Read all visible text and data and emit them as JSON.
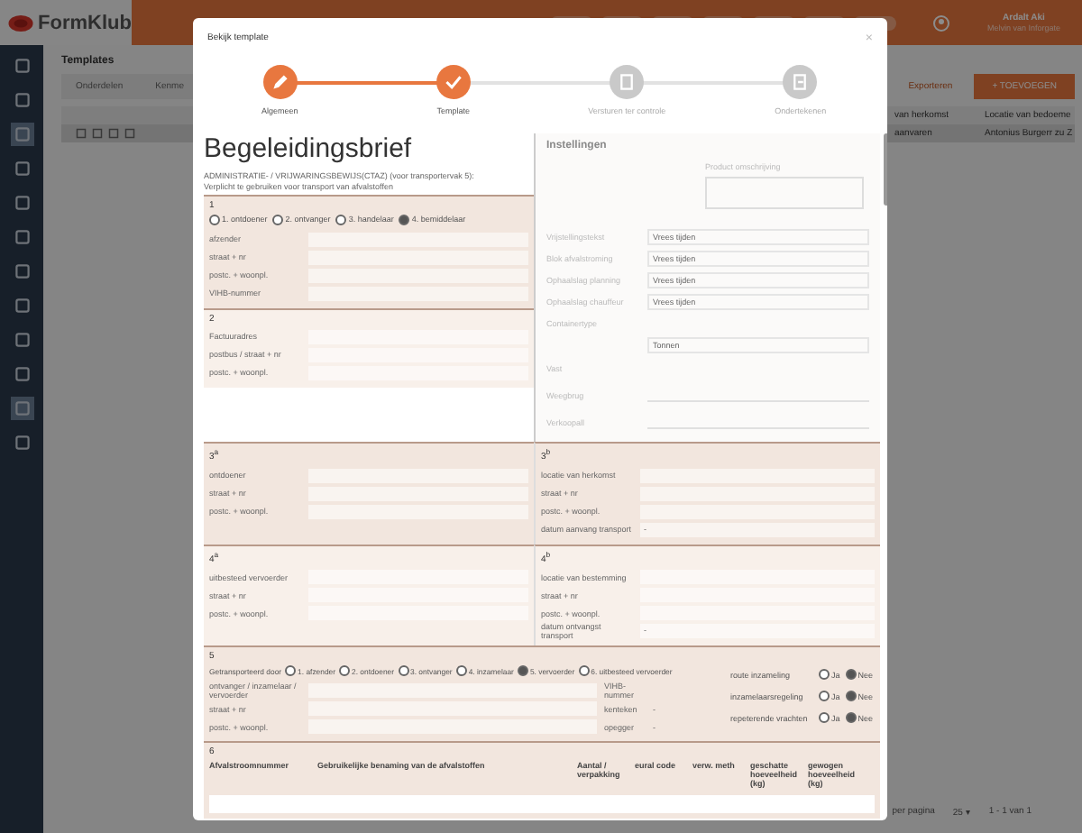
{
  "app": {
    "brand": "FormKlub",
    "user_name": "Ardalt Aki",
    "user_org": "Melvin van Inforgate",
    "page_title": "Templates",
    "tabs": [
      "Onderdelen",
      "Kenme"
    ],
    "actions": [
      "Exporteren",
      "+ TOEVOEGEN"
    ],
    "columns": [
      "van herkomst",
      "Locatie van bedoeme"
    ],
    "row": [
      "aanvaren",
      "Antonius Burgerr zu Z"
    ],
    "pagination": [
      "per pagina",
      "25 ▾",
      "1 - 1 van 1"
    ],
    "nav_items": [
      {
        "selected": false
      },
      {
        "selected": false
      },
      {
        "selected": true
      },
      {
        "selected": false
      },
      {
        "selected": false
      },
      {
        "selected": false
      },
      {
        "selected": false
      },
      {
        "selected": false
      },
      {
        "selected": false
      },
      {
        "selected": false
      },
      {
        "selected": true
      },
      {
        "selected": false
      }
    ]
  },
  "modal": {
    "title": "Bekijk template",
    "close": "×",
    "steps": [
      {
        "label": "Algemeen",
        "completed": true
      },
      {
        "label": "Template",
        "completed": true
      },
      {
        "label": "Versturen ter controle",
        "completed": false
      },
      {
        "label": "Ondertekenen",
        "completed": false
      }
    ]
  },
  "form": {
    "title": "Begeleidingsbrief",
    "intro": "ADMINISTRATIE- / VRIJWARINGSBEWIJS(CTAZ) (voor transportervak 5):",
    "intro_2": "Verplicht te gebruiken voor transport van afvalstoffen",
    "section_1": {
      "number": "1",
      "radios": [
        {
          "label": "1. ontdoener",
          "selected": false
        },
        {
          "label": "2. ontvanger",
          "selected": false
        },
        {
          "label": "3. handelaar",
          "selected": false
        },
        {
          "label": "4. bemiddelaar",
          "selected": true
        }
      ],
      "fields": [
        "afzender",
        "straat + nr",
        "postc. + woonpl.",
        "VIHB-nummer"
      ]
    },
    "section_2": {
      "number": "2",
      "fields": [
        "Factuuradres",
        "postbus / straat + nr",
        "postc. + woonpl."
      ]
    },
    "section_3a": {
      "number": "3$^{a}$",
      "fields": [
        "ontdoener",
        "straat + nr",
        "postc. + woonpl."
      ]
    },
    "section_3b": {
      "number": "3$^{b}$",
      "fields": [
        "locatie van herkomst",
        "straat + nr",
        "postc. +  woonpl.",
        "datum aanvang transport"
      ],
      "date": "-"
    },
    "section_4a": {
      "number": "4$^{a}$",
      "fields": [
        "uitbesteed vervoerder",
        "straat + nr",
        "postc. + woonpl."
      ]
    },
    "section_4b": {
      "number": "4$^{b}$",
      "fields": [
        "locatie van bestemming",
        "straat + nr",
        "postc. + woonpl.",
        "datum ontvangst transport"
      ],
      "date": "-"
    },
    "section_5": {
      "number": "5",
      "label": "Getransporteerd door",
      "radios": [
        {
          "label": "1. afzender",
          "selected": false
        },
        {
          "label": "2. ontdoener",
          "selected": false
        },
        {
          "label": "3. ontvanger",
          "selected": false
        },
        {
          "label": "4. inzamelaar",
          "selected": false
        },
        {
          "label": "5. vervoerder",
          "selected": true
        },
        {
          "label": "6. uitbesteed vervoerder",
          "selected": false
        }
      ],
      "fields": [
        "ontvanger / inzamelaar / vervoerder",
        "straat + nr",
        "postc. + woonpl."
      ],
      "details": [
        {
          "label": "VIHB-nummer"
        },
        {
          "label": "kenteken",
          "value": "-"
        },
        {
          "label": "opegger",
          "value": "-"
        }
      ],
      "options": [
        {
          "label": "route inzameling",
          "choices": [
            {
              "label": "Ja",
              "selected": false
            },
            {
              "label": "Nee",
              "selected": true
            }
          ]
        },
        {
          "label": "inzamelaarsregeling",
          "choices": [
            {
              "label": "Ja",
              "selected": false
            },
            {
              "label": "Nee",
              "selected": true
            }
          ]
        },
        {
          "label": "repeterende vrachten",
          "choices": [
            {
              "label": "Ja",
              "selected": false
            },
            {
              "label": "Nee",
              "selected": true
            }
          ]
        }
      ]
    },
    "section_6": {
      "number": "6",
      "columns": [
        "Afvalstroomnummer",
        "Gebruikelijke benaming van de afvalstoffen",
        "Aantal / verpakking",
        "eural code",
        "verw. meth",
        "geschatte hoeveelheid (kg)",
        "gewogen hoeveelheid (kg)"
      ]
    }
  },
  "settings": {
    "title": "Instellingen",
    "description_label": "Product omschrijving",
    "fields": [
      {
        "label": "Vrijstellingstekst",
        "value": "Vrees tijden"
      },
      {
        "label": "Blok afvalstroming",
        "value": "Vrees tijden"
      },
      {
        "label": "Ophaalslag planning",
        "value": "Vrees tijden"
      },
      {
        "label": "Ophaalslag chauffeur",
        "value": "Vrees tijden"
      }
    ],
    "container_label": "Containertype",
    "container_value": "Tonnen",
    "extra_labels": [
      "Vast",
      "Weegbrug",
      "Verkoopall"
    ]
  }
}
